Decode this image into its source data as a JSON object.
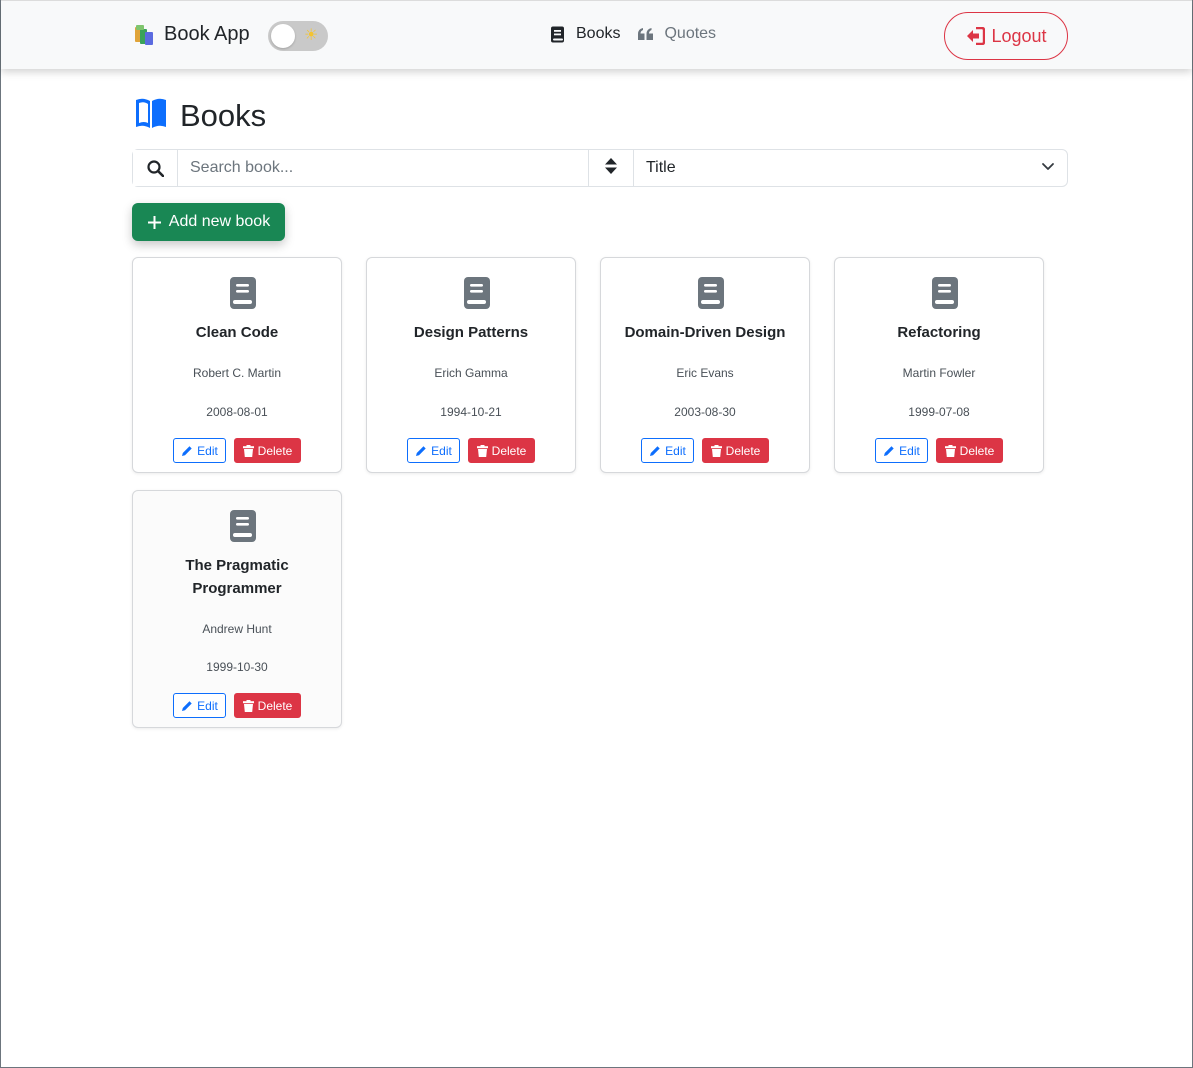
{
  "navbar": {
    "brand": "Book App",
    "theme_toggle_icon": "sun-icon",
    "links": [
      {
        "label": "Books",
        "icon": "book-icon",
        "active": true
      },
      {
        "label": "Quotes",
        "icon": "quote-icon",
        "active": false
      }
    ],
    "logout_label": "Logout"
  },
  "page": {
    "title": "Books"
  },
  "search": {
    "placeholder": "Search book...",
    "value": "",
    "sort_selected": "Title"
  },
  "add_button_label": "Add new book",
  "colors": {
    "primary": "#0d6efd",
    "success": "#198754",
    "danger": "#dc3545",
    "muted": "#6c757d"
  },
  "books": [
    {
      "title": "Clean Code",
      "author": "Robert C. Martin",
      "date": "2008-08-01",
      "edit_label": "Edit",
      "delete_label": "Delete"
    },
    {
      "title": "Design Patterns",
      "author": "Erich Gamma",
      "date": "1994-10-21",
      "edit_label": "Edit",
      "delete_label": "Delete"
    },
    {
      "title": "Domain-Driven Design",
      "author": "Eric Evans",
      "date": "2003-08-30",
      "edit_label": "Edit",
      "delete_label": "Delete"
    },
    {
      "title": "Refactoring",
      "author": "Martin Fowler",
      "date": "1999-07-08",
      "edit_label": "Edit",
      "delete_label": "Delete"
    },
    {
      "title": "The Pragmatic Programmer",
      "author": "Andrew Hunt",
      "date": "1999-10-30",
      "edit_label": "Edit",
      "delete_label": "Delete"
    }
  ]
}
